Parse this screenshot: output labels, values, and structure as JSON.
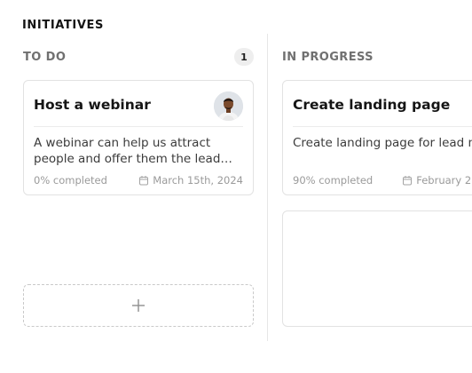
{
  "section": {
    "title": "INITIATIVES"
  },
  "columns": [
    {
      "label": "TO DO",
      "count": "1",
      "cards": [
        {
          "title": "Host a webinar",
          "description": "A webinar can help us attract people and offer them the lead…",
          "progress": "0% completed",
          "progress_fraction": 0,
          "due_date": "March 15th, 2024",
          "has_avatar": true
        }
      ]
    },
    {
      "label": "IN PROGRESS",
      "cards": [
        {
          "title": "Create landing page",
          "description": "Create landing page for lead magnet",
          "progress": "90% completed",
          "progress_fraction": 0.9,
          "due_date": "February 2"
        }
      ]
    }
  ],
  "icons": {
    "calendar": "calendar-icon",
    "add": "plus-icon",
    "avatar": "avatar"
  }
}
